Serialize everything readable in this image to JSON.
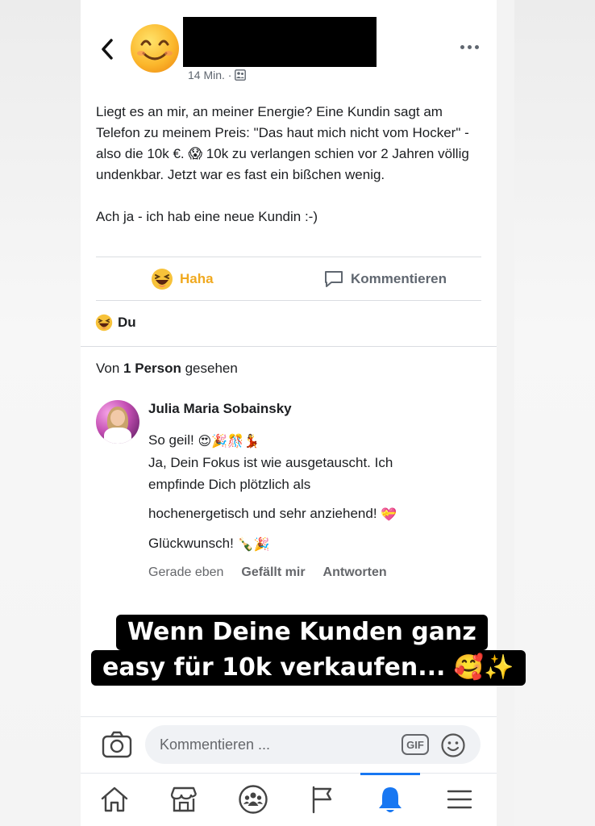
{
  "header": {
    "back_label": "back",
    "time_meta": "14 Min. ·",
    "avatar_icon": "smiling-face-emoji",
    "audience_icon": "friends-audience-icon"
  },
  "post": {
    "paragraph1": "Liegt es an mir, an meiner Energie? Eine Kundin sagt am Telefon zu meinem Preis: \"Das haut mich nicht vom Hocker\" - also die 10k €. 😱 10k zu verlangen schien vor 2 Jahren völlig undenkbar. Jetzt war es fast ein bißchen wenig.",
    "paragraph2": "Ach ja - ich hab eine neue Kundin :-)"
  },
  "actions": {
    "haha_label": "Haha",
    "comment_label": "Kommentieren"
  },
  "reactions": {
    "by": "Du"
  },
  "seen": {
    "prefix": "Von ",
    "count": "1 Person",
    "suffix": " gesehen"
  },
  "comment": {
    "author": "Julia Maria Sobainsky",
    "line1_text": "So geil! ",
    "line1_emoji": "😍🎉🎊💃",
    "line2": "Ja, Dein Fokus ist wie ausgetauscht. Ich",
    "line3": "empfinde Dich plötzlich als",
    "line4_text": "hochenergetisch und sehr anziehend! ",
    "line4_emoji": "💝",
    "line5_text": "Glückwunsch! ",
    "line5_emoji": "🍾🎉",
    "time": "Gerade eben",
    "like": "Gefällt mir",
    "reply": "Antworten"
  },
  "caption": {
    "line1": "Wenn Deine Kunden ganz",
    "line2": "easy für 10k verkaufen... 🥰✨"
  },
  "composer": {
    "placeholder": "Kommentieren ...",
    "gif_label": "GIF"
  },
  "nav": {
    "items": [
      "home-icon",
      "marketplace-icon",
      "groups-icon",
      "pages-flag-icon",
      "notifications-bell-icon",
      "menu-icon"
    ],
    "active": "notifications-bell-icon",
    "active_color": "#1877f2"
  },
  "colors": {
    "haha": "#f0a91f",
    "secondary_text": "#65676b"
  }
}
